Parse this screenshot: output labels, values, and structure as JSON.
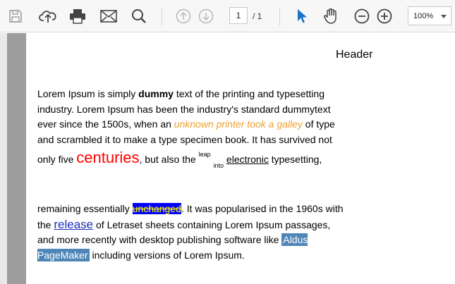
{
  "toolbar": {
    "icons": [
      "save-icon",
      "upload-icon",
      "print-icon",
      "email-icon",
      "search-icon",
      "arrow-up-icon",
      "arrow-down-icon",
      "pointer-icon",
      "hand-icon",
      "zoom-out-icon",
      "zoom-in-icon"
    ],
    "page_current": "1",
    "page_total": "/ 1",
    "zoom": "100%",
    "accent": "#1a73c8"
  },
  "document": {
    "header": "Header",
    "p1": {
      "t1": "Lorem Ipsum is simply ",
      "bold": "dummy",
      "t2": " text of the printing and typesetting industry. Lorem Ipsum has been the industry's standard dummytext ever since the 1500s, when an ",
      "orange": "unknown printer took a galley",
      "t3": " of type and scrambled it to make a type specimen book. It has survived not only five ",
      "big": "centuries",
      "t4": ", but also the ",
      "sup": "leap",
      "sub": "into",
      "underline": "electronic",
      "t5": " typesetting,"
    },
    "p2": {
      "t1": "remaining essentially ",
      "highlight": "unchanged",
      "t2": ". It was popularised in the 1960s with the ",
      "link": "release",
      "t3": " of Letraset sheets containing Lorem Ipsum passages, and more recently with desktop publishing software like ",
      "selected": "Aldus PageMaker",
      "t4": " including versions of Lorem Ipsum."
    }
  }
}
